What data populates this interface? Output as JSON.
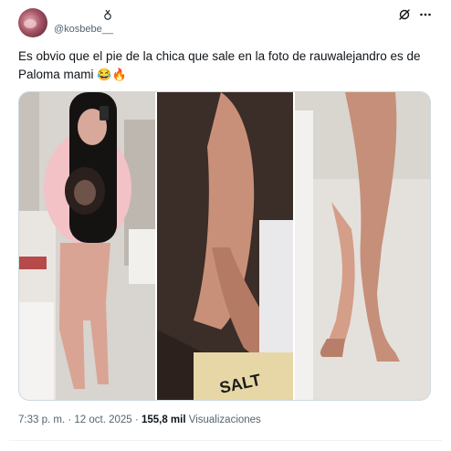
{
  "tweet": {
    "handle": "@kosbebe__",
    "text": "Es obvio que el pie de la chica que sale en la foto de rauwalejandro es de Paloma mami",
    "emojis": "😂🔥",
    "time": "7:33 p. m.",
    "separator": "·",
    "date": "12 oct. 2025",
    "views_count": "155,8 mil",
    "views_label": "Visualizaciones"
  },
  "icons": {
    "verified": "verified-icon",
    "grok": "grok-icon",
    "more": "more-icon"
  },
  "media": {
    "photos": [
      {
        "name": "photo-mirror-selfie"
      },
      {
        "name": "photo-foot-closeup"
      },
      {
        "name": "photo-legs-closeup"
      }
    ]
  },
  "colors": {
    "text": "#0f1419",
    "secondary": "#536471",
    "border": "#cfd9de"
  }
}
